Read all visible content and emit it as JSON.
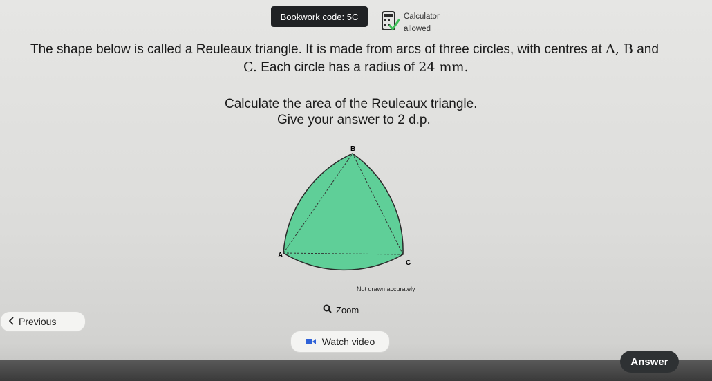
{
  "header": {
    "bookwork_code": "Bookwork code: 5C",
    "calculator_line1": "Calculator",
    "calculator_line2": "allowed"
  },
  "question": {
    "line1": "The shape below is called a Reuleaux triangle. It is made from arcs of three circles, with centres at",
    "centres": "A, B",
    "and1": "and",
    "line2_c": "C.",
    "line2_text": "Each circle has a radius of",
    "radius": "24 mm.",
    "instruction": "Calculate the area of the Reuleaux triangle.",
    "precision": "Give your answer to 2 d.p."
  },
  "diagram": {
    "label_a": "A",
    "label_b": "B",
    "label_c": "C",
    "fill_color": "#5fcf98",
    "note": "Not drawn accurately"
  },
  "controls": {
    "zoom_label": "Zoom",
    "previous_label": "Previous",
    "watch_video_label": "Watch video",
    "answer_label": "Answer"
  }
}
